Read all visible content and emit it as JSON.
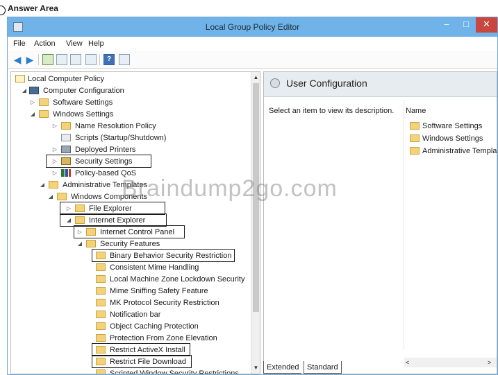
{
  "page": {
    "heading": "Answer Area"
  },
  "window": {
    "title": "Local Group Policy Editor",
    "minimize": "–",
    "maximize": "□",
    "close": "✕"
  },
  "menu": [
    "File",
    "Action",
    "View",
    "Help"
  ],
  "tree": {
    "root": "Local Computer Policy",
    "computer_configuration": "Computer Configuration",
    "software_settings": "Software Settings",
    "windows_settings": "Windows Settings",
    "name_resolution_policy": "Name Resolution Policy",
    "scripts": "Scripts (Startup/Shutdown)",
    "deployed_printers": "Deployed Printers",
    "security_settings": "Security Settings",
    "policy_based_qos": "Policy-based QoS",
    "administrative_templates": "Administrative Templates",
    "windows_components": "Windows Components",
    "file_explorer": "File Explorer",
    "internet_explorer": "Internet Explorer",
    "internet_control_panel": "Internet Control Panel",
    "security_features": "Security Features",
    "features": [
      "Binary Behavior Security Restriction",
      "Consistent Mime Handling",
      "Local Machine Zone Lockdown Security",
      "Mime Sniffing Safety Feature",
      "MK Protocol Security Restriction",
      "Notification bar",
      "Object Caching Protection",
      "Protection From Zone Elevation",
      "Restrict ActiveX Install",
      "Restrict File Download",
      "Scripted Window Security Restrictions"
    ]
  },
  "details": {
    "title": "User Configuration",
    "description": "Select an item to view its description.",
    "column_name": "Name",
    "items": [
      "Software Settings",
      "Windows Settings",
      "Administrative Templates"
    ]
  },
  "tabs": {
    "extended": "Extended",
    "standard": "Standard"
  },
  "watermark": "Braindump2go.com"
}
